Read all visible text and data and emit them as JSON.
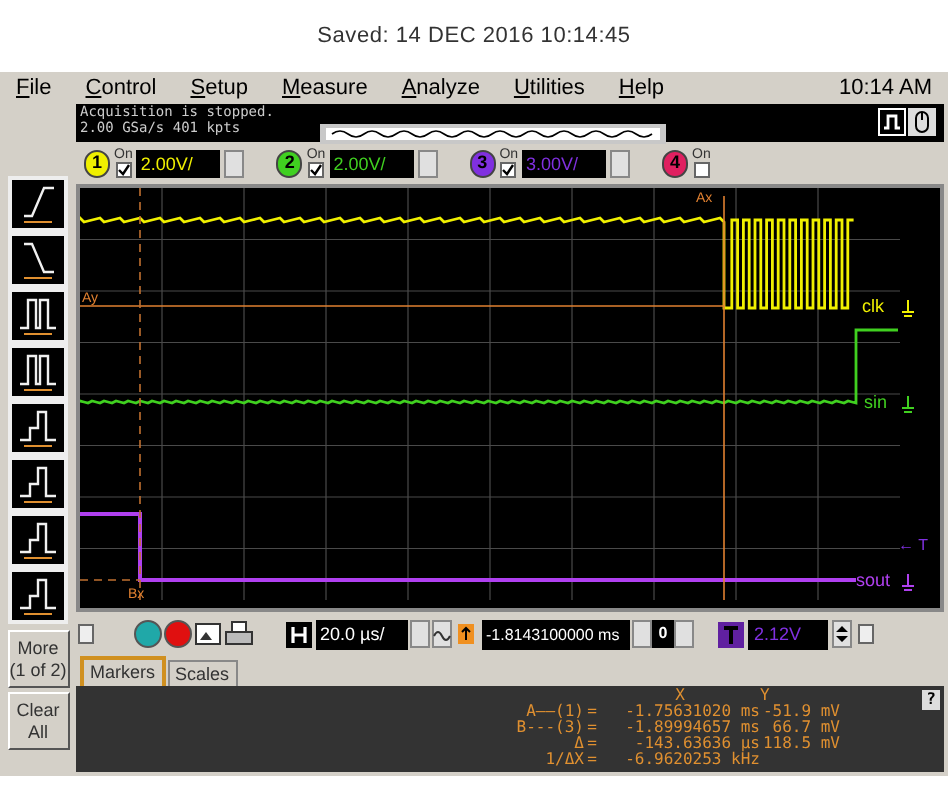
{
  "saved_line": "Saved:  14 DEC 2016  10:14:45",
  "menu": [
    "File",
    "Control",
    "Setup",
    "Measure",
    "Analyze",
    "Utilities",
    "Help"
  ],
  "clock": "10:14 AM",
  "status": {
    "line_1": "Acquisition is stopped.",
    "line_2": "2.00 GSa/s   401 kpts"
  },
  "channels": [
    {
      "number": "1",
      "label": "On",
      "on": true,
      "scale": "2.00V/",
      "color": "#f0f000"
    },
    {
      "number": "2",
      "label": "On",
      "on": true,
      "scale": "2.00V/",
      "color": "#40d020"
    },
    {
      "number": "3",
      "label": "On",
      "on": true,
      "scale": "3.00V/",
      "color": "#8030e0"
    },
    {
      "number": "4",
      "label": "On",
      "on": false,
      "color": "#e02060"
    }
  ],
  "traces": [
    {
      "label": "clk",
      "color": "#f0f000"
    },
    {
      "label": "sin",
      "color": "#40d020"
    },
    {
      "label": "sout",
      "color": "#b040f0"
    }
  ],
  "markers": {
    "ax": "Ax",
    "ay": "Ay",
    "bx": "Bx",
    "trigger": "← T"
  },
  "toolbar": {
    "more": "More (1 of 2)",
    "clear": "Clear All"
  },
  "controls": {
    "timebase": "20.0 µs/",
    "delay": "-1.8143100000 ms",
    "delay_step": "0",
    "trigger_level": "2.12V"
  },
  "tabs": [
    {
      "label": "Markers",
      "selected": true
    },
    {
      "label": "Scales",
      "selected": false
    }
  ],
  "readout": {
    "x_header": "X",
    "y_header": "Y",
    "help": "?",
    "rows": [
      {
        "label": "A——(1)",
        "eq": "=",
        "x": "-1.75631020 ms",
        "y": "-51.9 mV"
      },
      {
        "label": "B---(3)",
        "eq": "=",
        "x": "-1.89994657 ms",
        "y": "66.7 mV"
      },
      {
        "label": "Δ",
        "eq": "=",
        "x": "-143.63636 µs",
        "y": "118.5 mV"
      },
      {
        "label": "1/ΔX",
        "eq": "=",
        "x": "-6.9620253 kHz"
      }
    ]
  }
}
